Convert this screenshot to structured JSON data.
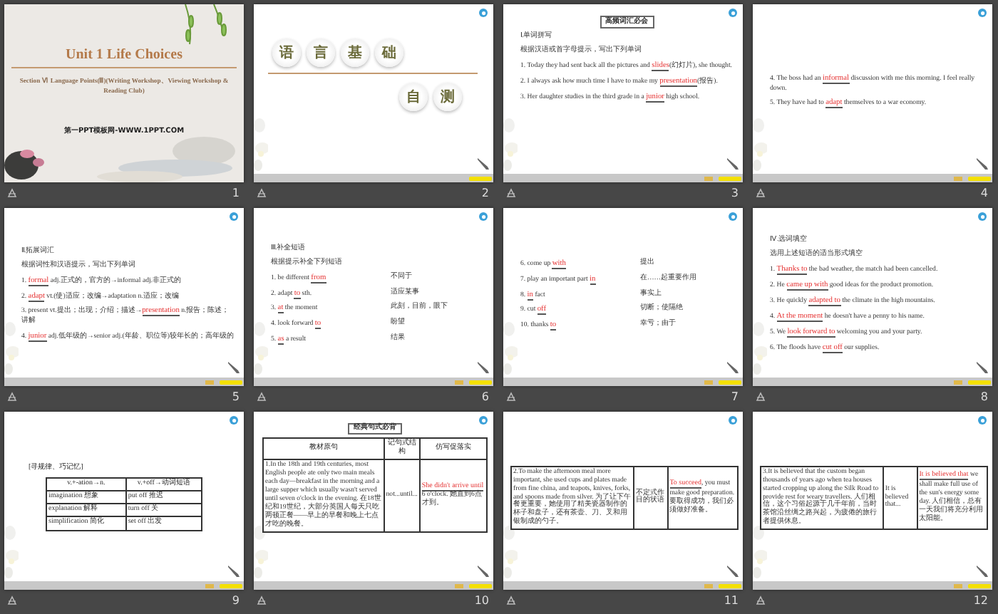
{
  "slides": [
    {
      "number": "1",
      "kind": "title",
      "title": "Unit 1  Life Choices",
      "subtitle": "Section Ⅵ  Language Points(Ⅲ)(Writing Workshop、Viewing Workshop & Reading Club)",
      "footer": "第一PPT模板网-WWW.1PPT.COM"
    },
    {
      "number": "2",
      "kind": "section",
      "heading": [
        "语",
        "言",
        "基",
        "础"
      ],
      "subheading": [
        "自",
        "测"
      ]
    },
    {
      "number": "3",
      "kind": "lines",
      "banner": "高频词汇必会",
      "lines": [
        {
          "parts": [
            {
              "kind": "text",
              "text": "Ⅰ.单词拼写"
            }
          ]
        },
        {
          "parts": [
            {
              "kind": "text",
              "text": "根据汉语或首字母提示，写出下列单词"
            }
          ]
        },
        {
          "parts": [
            {
              "kind": "text",
              "text": "1. Today they had sent back all the pictures and "
            },
            {
              "kind": "answer",
              "text": "slides"
            },
            {
              "kind": "text",
              "text": "(幻灯片), she thought."
            }
          ]
        },
        {
          "parts": [
            {
              "kind": "text",
              "text": "2. I always ask how much time I have to make my "
            },
            {
              "kind": "answer",
              "text": "presentation"
            },
            {
              "kind": "text",
              "text": "(报告)."
            }
          ]
        },
        {
          "parts": [
            {
              "kind": "text",
              "text": "3. Her daughter studies in the third grade in a "
            },
            {
              "kind": "answer",
              "text": "junior"
            },
            {
              "kind": "text",
              "text": " high school."
            }
          ]
        }
      ]
    },
    {
      "number": "4",
      "kind": "lines",
      "lines": [
        {
          "parts": [
            {
              "kind": "text",
              "text": "4. The boss had an "
            },
            {
              "kind": "answer",
              "text": "informal"
            },
            {
              "kind": "text",
              "text": " discussion with me this morning. I feel really down."
            }
          ]
        },
        {
          "parts": [
            {
              "kind": "text",
              "text": "5. They have had to "
            },
            {
              "kind": "answer",
              "text": "adapt"
            },
            {
              "kind": "text",
              "text": " themselves to a war economy."
            }
          ]
        }
      ]
    },
    {
      "number": "5",
      "kind": "lines",
      "lines": [
        {
          "parts": [
            {
              "kind": "text",
              "text": "Ⅱ.拓展词汇"
            }
          ]
        },
        {
          "parts": [
            {
              "kind": "text",
              "text": "根据词性和汉语提示，写出下列单词"
            }
          ]
        },
        {
          "parts": [
            {
              "kind": "text",
              "text": "1. "
            },
            {
              "kind": "answer",
              "text": "formal"
            },
            {
              "kind": "text",
              "text": " adj.正式的，官方的→informal adj.非正式的"
            }
          ]
        },
        {
          "parts": [
            {
              "kind": "text",
              "text": "2. "
            },
            {
              "kind": "answer",
              "text": "adapt"
            },
            {
              "kind": "text",
              "text": " vt.(使)适应；改编→adaptation n.适应；改编"
            }
          ]
        },
        {
          "parts": [
            {
              "kind": "text",
              "text": "3. present vt.提出；出现；介绍；描述→"
            },
            {
              "kind": "answer",
              "text": "presentation"
            },
            {
              "kind": "text",
              "text": " n.报告；陈述；讲解"
            }
          ]
        },
        {
          "parts": [
            {
              "kind": "text",
              "text": "4. "
            },
            {
              "kind": "answer",
              "text": "junior"
            },
            {
              "kind": "text",
              "text": " adj.低年级的→senior adj.(年龄、职位等)较年长的；高年级的"
            }
          ]
        }
      ]
    },
    {
      "number": "6",
      "kind": "lines",
      "lines": [
        {
          "parts": [
            {
              "kind": "text",
              "text": "Ⅲ.补全短语"
            }
          ]
        },
        {
          "parts": [
            {
              "kind": "text",
              "text": "根据提示补全下列短语"
            }
          ]
        },
        {
          "parts": [
            {
              "kind": "text",
              "text": "1. be different "
            },
            {
              "kind": "answer",
              "text": "from"
            }
          ],
          "gloss": "不同于"
        },
        {
          "parts": [
            {
              "kind": "text",
              "text": "2. adapt "
            },
            {
              "kind": "answer",
              "text": "to"
            },
            {
              "kind": "text",
              "text": " sth."
            }
          ],
          "gloss": "适应某事"
        },
        {
          "parts": [
            {
              "kind": "text",
              "text": "3. "
            },
            {
              "kind": "answer",
              "text": "at"
            },
            {
              "kind": "text",
              "text": " the moment"
            }
          ],
          "gloss": "此刻，目前，眼下"
        },
        {
          "parts": [
            {
              "kind": "text",
              "text": "4. look forward "
            },
            {
              "kind": "answer",
              "text": "to"
            }
          ],
          "gloss": "盼望"
        },
        {
          "parts": [
            {
              "kind": "text",
              "text": "5. "
            },
            {
              "kind": "answer",
              "text": "as"
            },
            {
              "kind": "text",
              "text": " a result"
            }
          ],
          "gloss": "结果"
        }
      ]
    },
    {
      "number": "7",
      "kind": "lines",
      "lines": [
        {
          "parts": [
            {
              "kind": "text",
              "text": "6. come up "
            },
            {
              "kind": "answer",
              "text": "with"
            }
          ],
          "gloss": "提出"
        },
        {
          "parts": [
            {
              "kind": "text",
              "text": "7. play an important part "
            },
            {
              "kind": "answer",
              "text": "in"
            }
          ],
          "gloss": "在……起重要作用"
        },
        {
          "parts": [
            {
              "kind": "text",
              "text": "8. "
            },
            {
              "kind": "answer",
              "text": "in"
            },
            {
              "kind": "text",
              "text": " fact"
            }
          ],
          "gloss": "事实上"
        },
        {
          "parts": [
            {
              "kind": "text",
              "text": "9. cut "
            },
            {
              "kind": "answer",
              "text": "off"
            }
          ],
          "gloss": "切断；使隔绝"
        },
        {
          "parts": [
            {
              "kind": "text",
              "text": "10. thanks "
            },
            {
              "kind": "answer",
              "text": "to"
            }
          ],
          "gloss": "幸亏；由于"
        }
      ]
    },
    {
      "number": "8",
      "kind": "lines",
      "lines": [
        {
          "parts": [
            {
              "kind": "text",
              "text": "Ⅳ.选词填空"
            }
          ]
        },
        {
          "parts": [
            {
              "kind": "text",
              "text": "选用上述短语的适当形式填空"
            }
          ]
        },
        {
          "parts": [
            {
              "kind": "text",
              "text": "1. "
            },
            {
              "kind": "answer",
              "text": "Thanks to"
            },
            {
              "kind": "text",
              "text": " the bad weather, the match had been cancelled."
            }
          ]
        },
        {
          "parts": [
            {
              "kind": "text",
              "text": "2. He "
            },
            {
              "kind": "answer",
              "text": "came up with"
            },
            {
              "kind": "text",
              "text": " good ideas for the product promotion."
            }
          ]
        },
        {
          "parts": [
            {
              "kind": "text",
              "text": "3. He quickly "
            },
            {
              "kind": "answer",
              "text": "adapted to"
            },
            {
              "kind": "text",
              "text": " the climate in the high mountains."
            }
          ]
        },
        {
          "parts": [
            {
              "kind": "text",
              "text": "4. "
            },
            {
              "kind": "answer",
              "text": "At the moment"
            },
            {
              "kind": "text",
              "text": " he doesn't have a penny to his name."
            }
          ]
        },
        {
          "parts": [
            {
              "kind": "text",
              "text": "5. We "
            },
            {
              "kind": "answer",
              "text": "look forward to"
            },
            {
              "kind": "text",
              "text": " welcoming you and your party."
            }
          ]
        },
        {
          "parts": [
            {
              "kind": "text",
              "text": "6. The floods have "
            },
            {
              "kind": "answer",
              "text": "cut off"
            },
            {
              "kind": "text",
              "text": " our supplies."
            }
          ]
        }
      ]
    },
    {
      "number": "9",
      "kind": "table",
      "caption": "[寻规律、巧记忆]",
      "columns": [
        "v.+-ation→n.",
        "v.+off→动词短语"
      ],
      "rows": [
        [
          {
            "parts": [
              {
                "kind": "text",
                "text": "imagination 想象"
              }
            ]
          },
          {
            "parts": [
              {
                "kind": "text",
                "text": "put off 推迟"
              }
            ]
          }
        ],
        [
          {
            "parts": [
              {
                "kind": "text",
                "text": "explanation 解释"
              }
            ]
          },
          {
            "parts": [
              {
                "kind": "text",
                "text": "turn off 关"
              }
            ]
          }
        ],
        [
          {
            "parts": [
              {
                "kind": "text",
                "text": "simplification 简化"
              }
            ]
          },
          {
            "parts": [
              {
                "kind": "text",
                "text": "set off 出发"
              }
            ]
          }
        ]
      ]
    },
    {
      "number": "10",
      "kind": "table",
      "banner": "经典句式必背",
      "columns": [
        "教材原句",
        "记句式结构",
        "仿写促落实"
      ],
      "rows": [
        [
          {
            "parts": [
              {
                "kind": "text",
                "text": "1.In the 18th and 19th centuries, most English people ate only two main meals each day—breakfast in the morning and a large supper which usually wasn't served until seven o'clock in the evening. 在18世纪和19世纪，大部分英国人每天只吃两顿正餐——早上的早餐和晚上七点才吃的晚餐。"
              }
            ]
          },
          {
            "parts": [
              {
                "kind": "text",
                "text": "not...until..."
              }
            ]
          },
          {
            "parts": [
              {
                "kind": "answer",
                "text": "She didn't arrive until"
              },
              {
                "kind": "text",
                "text": " 6 o'clock. 她直到6点才到。"
              }
            ]
          }
        ]
      ]
    },
    {
      "number": "11",
      "kind": "table",
      "rows": [
        [
          {
            "parts": [
              {
                "kind": "text",
                "text": "2.To make the afternoon meal more important, she used cups and plates made from fine china, and teapots, knives, forks, and spoons made from silver. 为了让下午餐更重要，她使用了精美瓷器制作的杯子和盘子，还有茶壶、刀、叉和用银制成的勺子。"
              }
            ]
          },
          {
            "parts": [
              {
                "kind": "text",
                "text": "不定式作目的状语"
              }
            ]
          },
          {
            "parts": [
              {
                "kind": "answer",
                "text": "To succeed"
              },
              {
                "kind": "text",
                "text": ", you must make good preparation. 要取得成功，我们必须做好准备。"
              }
            ]
          }
        ]
      ]
    },
    {
      "number": "12",
      "kind": "table",
      "rows": [
        [
          {
            "parts": [
              {
                "kind": "text",
                "text": "3.It is believed that the custom began thousands of years ago when tea houses started cropping up along the Silk Road to provide rest for weary travellers. 人们相信，这个习俗起源于几千年前，当时茶馆沿丝绸之路兴起，为疲倦的旅行者提供休息。"
              }
            ]
          },
          {
            "parts": [
              {
                "kind": "text",
                "text": "It is believed that..."
              }
            ]
          },
          {
            "parts": [
              {
                "kind": "answer",
                "text": "It is believed that"
              },
              {
                "kind": "text",
                "text": " we shall make full use of the sun's energy some day. 人们相信，总有一天我们将充分利用太阳能。"
              }
            ]
          }
        ]
      ]
    }
  ]
}
